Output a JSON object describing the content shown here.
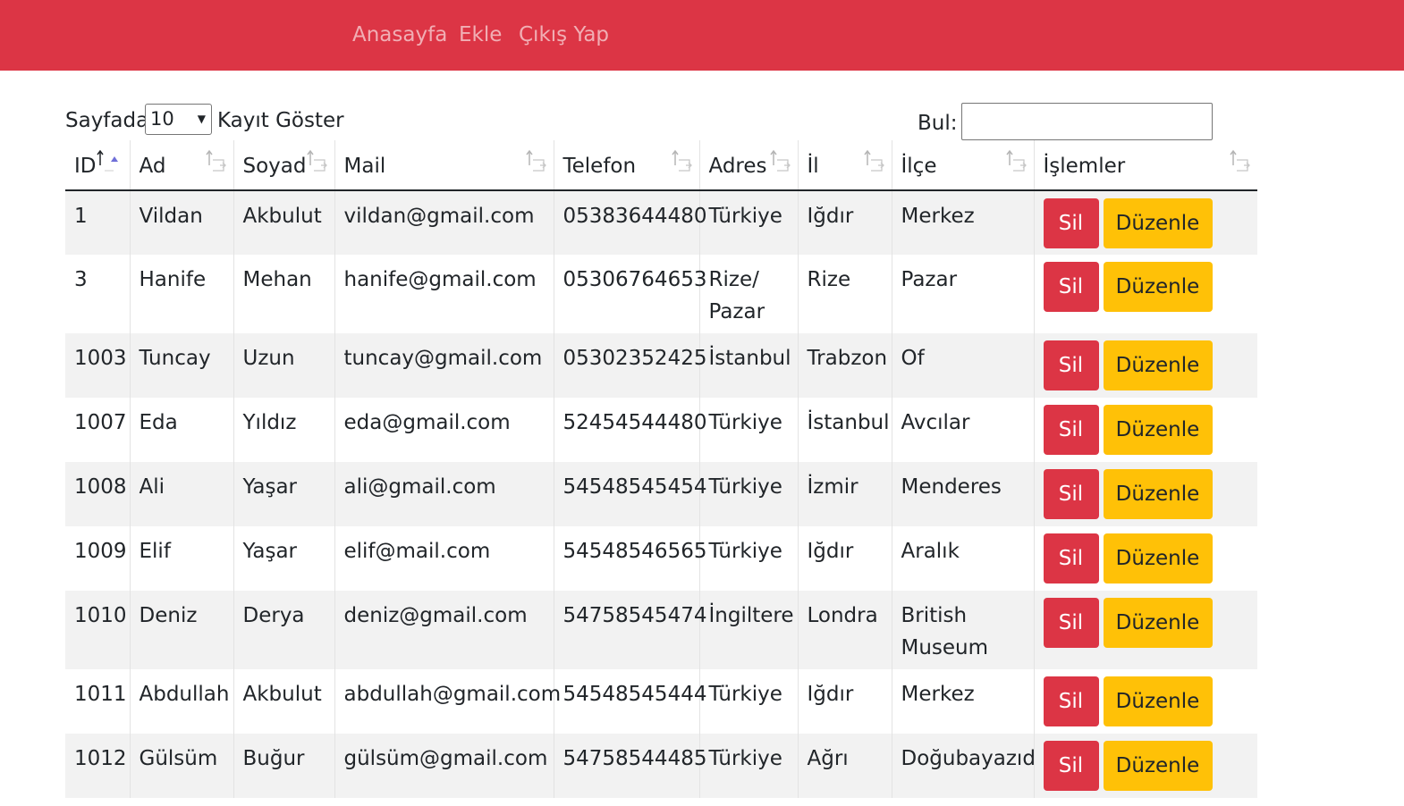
{
  "nav": {
    "home": "Anasayfa",
    "add": "Ekle",
    "logout": "Çıkış Yap"
  },
  "length": {
    "prefix": "Sayfada",
    "value": "10",
    "suffix": "Kayıt Göster"
  },
  "search": {
    "label": "Bul:",
    "value": ""
  },
  "columns": [
    "ID",
    "Ad",
    "Soyad",
    "Mail",
    "Telefon",
    "Adres",
    "İl",
    "İlçe",
    "İşlemler"
  ],
  "rows": [
    {
      "id": "1",
      "ad": "Vildan",
      "soyad": "Akbulut",
      "mail": "vildan@gmail.com",
      "telefon": "05383644480",
      "adres": "Türkiye",
      "il": "Iğdır",
      "ilce": "Merkez"
    },
    {
      "id": "3",
      "ad": "Hanife",
      "soyad": "Mehan",
      "mail": "hanife@gmail.com",
      "telefon": "05306764653",
      "adres": "Rize/ Pazar",
      "il": "Rize",
      "ilce": "Pazar"
    },
    {
      "id": "1003",
      "ad": "Tuncay",
      "soyad": "Uzun",
      "mail": "tuncay@gmail.com",
      "telefon": "05302352425",
      "adres": "İstanbul",
      "il": "Trabzon",
      "ilce": "Of"
    },
    {
      "id": "1007",
      "ad": "Eda",
      "soyad": "Yıldız",
      "mail": "eda@gmail.com",
      "telefon": "52454544480",
      "adres": "Türkiye",
      "il": "İstanbul",
      "ilce": "Avcılar"
    },
    {
      "id": "1008",
      "ad": "Ali",
      "soyad": "Yaşar",
      "mail": "ali@gmail.com",
      "telefon": "54548545454",
      "adres": "Türkiye",
      "il": "İzmir",
      "ilce": "Menderes"
    },
    {
      "id": "1009",
      "ad": "Elif",
      "soyad": "Yaşar",
      "mail": "elif@mail.com",
      "telefon": "54548546565",
      "adres": "Türkiye",
      "il": "Iğdır",
      "ilce": "Aralık"
    },
    {
      "id": "1010",
      "ad": "Deniz",
      "soyad": "Derya",
      "mail": "deniz@gmail.com",
      "telefon": "54758545474",
      "adres": "İngiltere",
      "il": "Londra",
      "ilce": "British Museum"
    },
    {
      "id": "1011",
      "ad": "Abdullah",
      "soyad": "Akbulut",
      "mail": "abdullah@gmail.com",
      "telefon": "54548545444",
      "adres": "Türkiye",
      "il": "Iğdır",
      "ilce": "Merkez"
    },
    {
      "id": "1012",
      "ad": "Gülsüm",
      "soyad": "Buğur",
      "mail": "gülsüm@gmail.com",
      "telefon": "54758544485",
      "adres": "Türkiye",
      "il": "Ağrı",
      "ilce": "Doğubayazıd"
    }
  ],
  "actions": {
    "delete": "Sil",
    "edit": "Düzenle"
  },
  "colors": {
    "navbar": "#dc3545",
    "delete_button": "#dc3545",
    "edit_button": "#ffc107",
    "stripe": "#f2f2f2"
  },
  "sort": {
    "active_column": "ID",
    "direction": "ascending"
  }
}
